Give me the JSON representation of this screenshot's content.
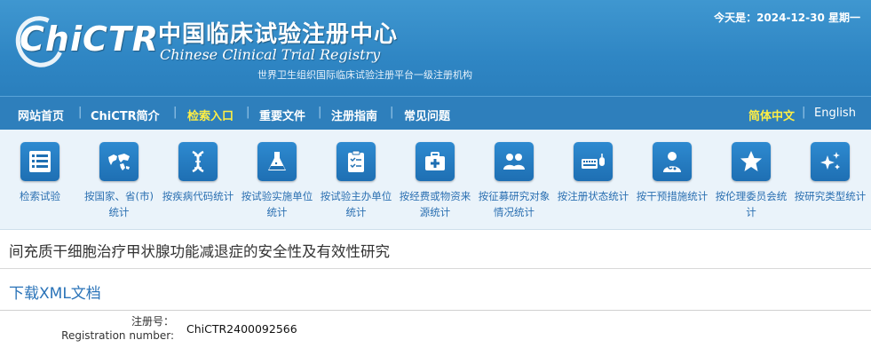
{
  "header": {
    "logo_text": "ChiCTR",
    "title_cn": "中国临床试验注册中心",
    "title_en": "Chinese Clinical Trial Registry",
    "subtitle": "世界卫生组织国际临床试验注册平台一级注册机构",
    "date_line": "今天是：2024-12-30 星期一"
  },
  "nav": {
    "items": [
      "网站首页",
      "ChiCTR简介",
      "检索入口",
      "重要文件",
      "注册指南",
      "常见问题"
    ],
    "active_index": 2,
    "lang_cn": "简体中文",
    "lang_en": "English"
  },
  "iconbar": {
    "items": [
      {
        "label": "检索试验",
        "icon": "list-icon"
      },
      {
        "label": "按国家、省(市)统计",
        "icon": "world-map-icon"
      },
      {
        "label": "按疾病代码统计",
        "icon": "dna-icon"
      },
      {
        "label": "按试验实施单位统计",
        "icon": "flask-icon"
      },
      {
        "label": "按试验主办单位统计",
        "icon": "clipboard-icon"
      },
      {
        "label": "按经费或物资来源统计",
        "icon": "medkit-icon"
      },
      {
        "label": "按征募研究对象情况统计",
        "icon": "people-icon"
      },
      {
        "label": "按注册状态统计",
        "icon": "keyboard-mouse-icon"
      },
      {
        "label": "按干预措施统计",
        "icon": "doctor-icon"
      },
      {
        "label": "按伦理委员会统计",
        "icon": "star-icon"
      },
      {
        "label": "按研究类型统计",
        "icon": "sparkle-icon"
      }
    ]
  },
  "content": {
    "trial_title": "间充质干细胞治疗甲状腺功能减退症的安全性及有效性研究",
    "xml_link": "下载XML文档",
    "reg_label_cn": "注册号：",
    "reg_label_en": "Registration number:",
    "reg_value": "ChiCTR2400092566"
  },
  "colors": {
    "header_blue": "#2f86c4",
    "nav_active": "#ffee44",
    "link_blue": "#2a73b8"
  }
}
